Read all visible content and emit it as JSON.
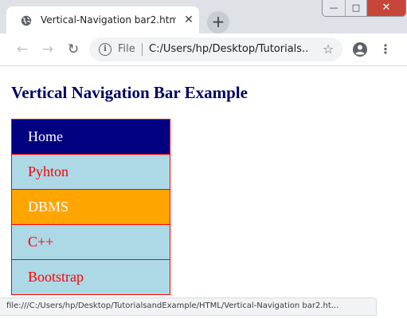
{
  "browser": {
    "tab": {
      "title": "Vertical-Navigation bar2.html",
      "close_symbol": "✕",
      "icon": "globe-icon"
    },
    "new_tab_symbol": "+",
    "window_controls": {
      "minimize": "—",
      "maximize": "□",
      "close": "✕"
    },
    "toolbar": {
      "back_symbol": "←",
      "forward_symbol": "→",
      "reload_symbol": "↻",
      "info_symbol": "i",
      "scheme_label": "File",
      "url": "C:/Users/hp/Desktop/Tutorials...",
      "bookmark_symbol": "☆",
      "menu_symbol": "⋮"
    },
    "status_url": "file:///C:/Users/hp/Desktop/TutorialsandExample/HTML/Vertical-Navigation bar2.ht..."
  },
  "page": {
    "heading": "Vertical Navigation Bar Example",
    "nav_items": [
      {
        "label": "Home",
        "state": "active"
      },
      {
        "label": "Pyhton",
        "state": "normal"
      },
      {
        "label": "DBMS",
        "state": "hover"
      },
      {
        "label": "C++",
        "state": "normal"
      },
      {
        "label": "Bootstrap",
        "state": "normal"
      }
    ]
  },
  "colors": {
    "heading": "#000066",
    "nav_background": "#add8e6",
    "nav_border": "#ff0000",
    "nav_link": "#ff0000",
    "active_background": "#000080",
    "hover_background": "#ffa500"
  }
}
